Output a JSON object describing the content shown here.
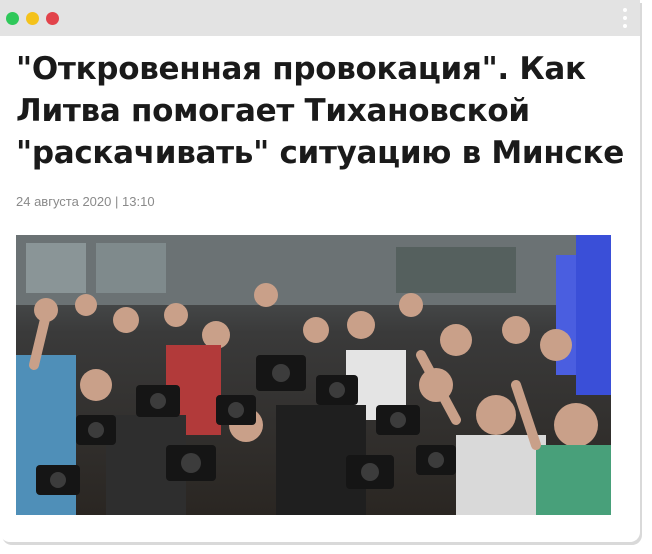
{
  "window": {
    "controls": [
      "close",
      "minimize",
      "maximize"
    ],
    "colors": {
      "green": "#34c759",
      "yellow": "#f5c518",
      "red": "#e5484d",
      "titlebar": "#e3e3e3"
    },
    "menu_icon": "kebab-icon"
  },
  "article": {
    "headline": "\"Откровенная провокация\". Как Литва помогает Тихановской \"раскачивать\" ситуацию в Минске",
    "date": "24 августа 2020",
    "separator": "|",
    "time": "13:10",
    "photo": {
      "subject": "crowd-of-journalists-with-cameras"
    }
  }
}
